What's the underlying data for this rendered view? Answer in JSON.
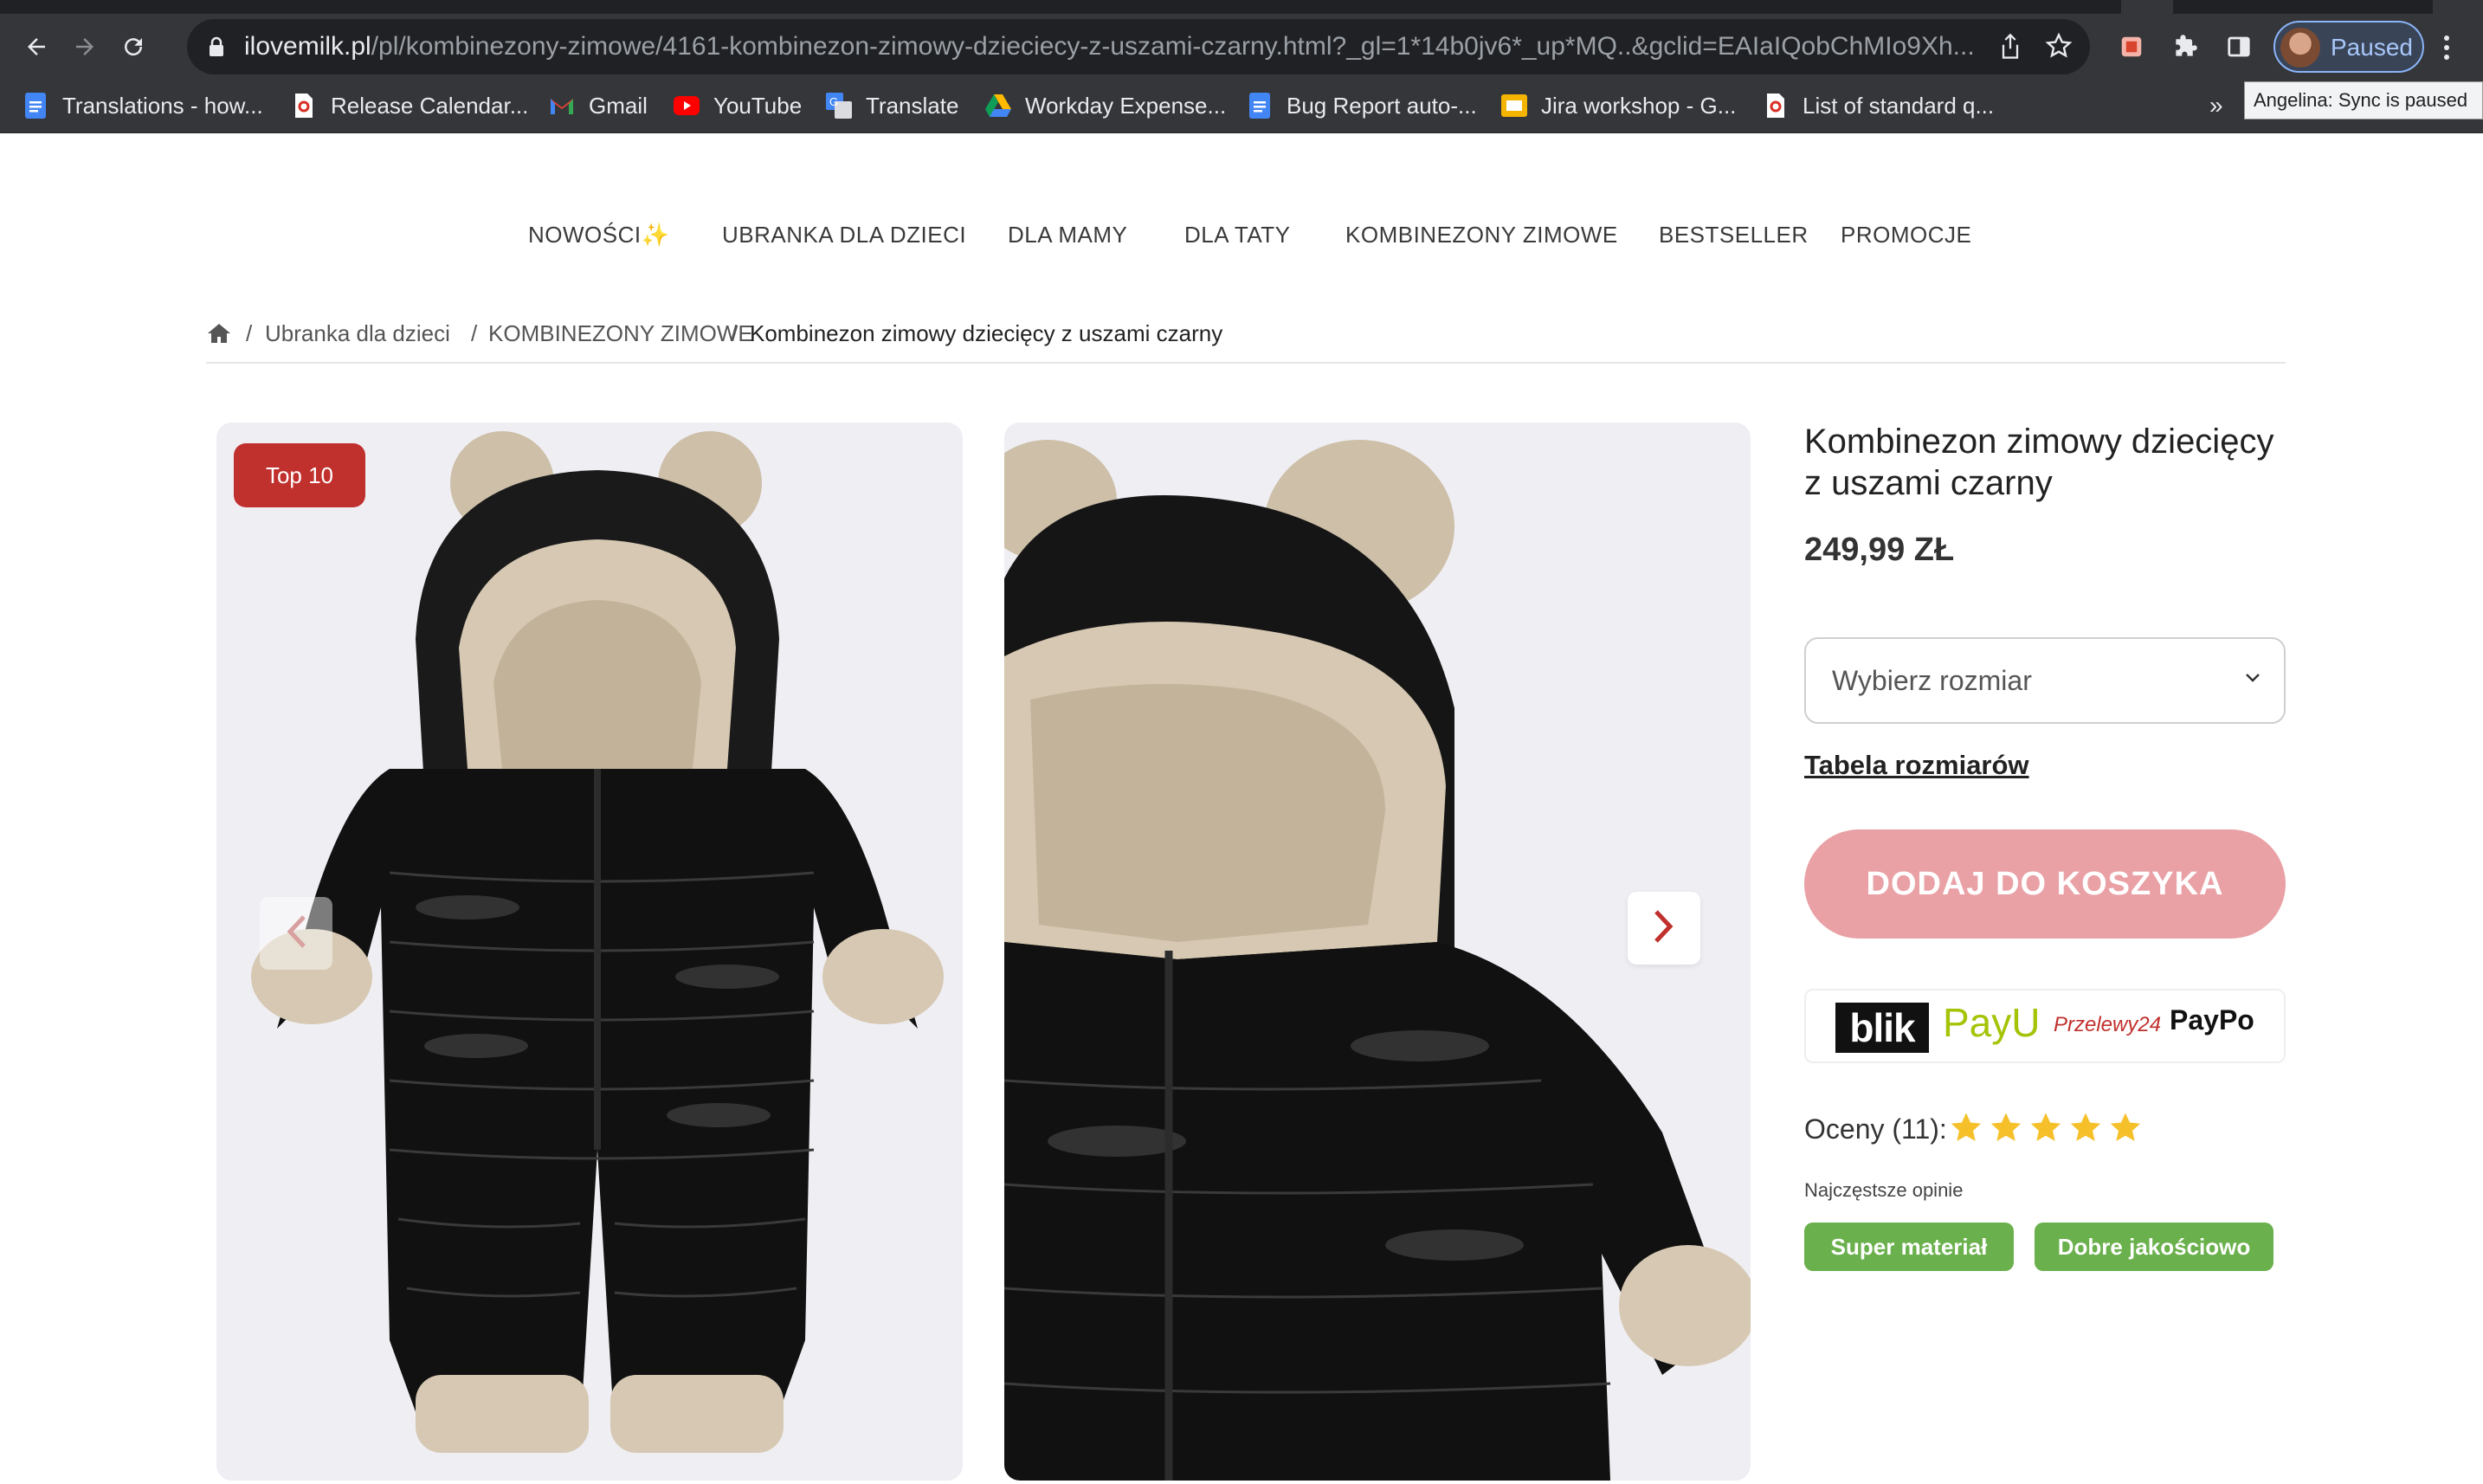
{
  "browser": {
    "url_host": "ilovemilk.pl",
    "url_path": "/pl/kombinezony-zimowe/4161-kombinezon-zimowy-dzieciecy-z-uszami-czarny.html?_gl=1*14b0jv6*_up*MQ..&gclid=EAIaIQobChMIo9Xh...",
    "profile_label": "Paused",
    "profile_tooltip": "Angelina: Sync is paused",
    "more_bookmarks": "»",
    "bookmarks": [
      {
        "label": "Translations - how...",
        "icon": "google-docs-icon"
      },
      {
        "label": "Release Calendar...",
        "icon": "page-icon"
      },
      {
        "label": "Gmail",
        "icon": "gmail-icon"
      },
      {
        "label": "YouTube",
        "icon": "youtube-icon"
      },
      {
        "label": "Translate",
        "icon": "translate-icon"
      },
      {
        "label": "Workday Expense...",
        "icon": "google-drive-icon"
      },
      {
        "label": "Bug Report auto-...",
        "icon": "google-docs-icon"
      },
      {
        "label": "Jira workshop - G...",
        "icon": "google-slides-icon"
      },
      {
        "label": "List of standard q...",
        "icon": "page-icon"
      }
    ]
  },
  "nav": {
    "items": [
      "NOWOŚCI✨",
      "UBRANKA DLA DZIECI",
      "DLA MAMY",
      "DLA TATY",
      "KOMBINEZONY ZIMOWE",
      "BESTSELLER",
      "PROMOCJE"
    ]
  },
  "breadcrumb": {
    "items": [
      "Ubranka dla dzieci",
      "KOMBINEZONY ZIMOWE",
      "Kombinezon zimowy dziecięcy z uszami czarny"
    ],
    "separator": "/"
  },
  "gallery": {
    "badge": "Top 10"
  },
  "product": {
    "title": "Kombinezon zimowy dziecięcy z uszami czarny",
    "price": "249,99 ZŁ",
    "size_placeholder": "Wybierz rozmiar",
    "size_table_link": "Tabela rozmiarów",
    "add_to_cart": "DODAJ DO KOSZYKA",
    "payments": [
      "blik",
      "PayU",
      "Przelewy24",
      "PayPo"
    ],
    "rating_label": "Oceny (11):",
    "rating_stars": 5,
    "opinions_label": "Najczęstsze opinie",
    "opinion_tags": [
      "Super materiał",
      "Dobre jakościowo"
    ]
  },
  "colors": {
    "accent_red": "#c0302d",
    "cart_button": "#e9a1a6",
    "tag_green": "#6ab04c",
    "star": "#f5c02a"
  }
}
